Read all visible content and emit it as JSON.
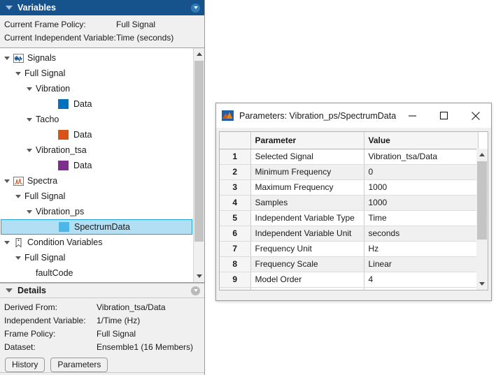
{
  "variables_panel": {
    "title": "Variables",
    "caret_icon": "caret-down-icon",
    "options_icon": "options-dropdown-icon",
    "properties": [
      {
        "label": "Current Frame Policy:",
        "value": "Full Signal"
      },
      {
        "label": "Current Independent Variable:",
        "value": "Time (seconds)"
      }
    ],
    "tree": [
      {
        "label": "Signals",
        "indent": 0,
        "twisty": true,
        "icon": "signals-waveform-icon",
        "selected": false
      },
      {
        "label": "Full Signal",
        "indent": 1,
        "twisty": true,
        "icon": null,
        "selected": false
      },
      {
        "label": "Vibration",
        "indent": 2,
        "twisty": true,
        "icon": null,
        "selected": false
      },
      {
        "label": "Data",
        "indent": 4,
        "twisty": false,
        "icon": null,
        "swatch": "#0072bd",
        "selected": false
      },
      {
        "label": "Tacho",
        "indent": 2,
        "twisty": true,
        "icon": null,
        "selected": false
      },
      {
        "label": "Data",
        "indent": 4,
        "twisty": false,
        "icon": null,
        "swatch": "#d95319",
        "selected": false
      },
      {
        "label": "Vibration_tsa",
        "indent": 2,
        "twisty": true,
        "icon": null,
        "selected": false
      },
      {
        "label": "Data",
        "indent": 4,
        "twisty": false,
        "icon": null,
        "swatch": "#7e2f8e",
        "selected": false
      },
      {
        "label": "Spectra",
        "indent": 0,
        "twisty": true,
        "icon": "spectra-peak-icon",
        "selected": false
      },
      {
        "label": "Full Signal",
        "indent": 1,
        "twisty": true,
        "icon": null,
        "selected": false
      },
      {
        "label": "Vibration_ps",
        "indent": 2,
        "twisty": true,
        "icon": null,
        "selected": false
      },
      {
        "label": "SpectrumData",
        "indent": 4,
        "twisty": false,
        "icon": null,
        "swatch": "#4db8e8",
        "selected": true
      },
      {
        "label": "Condition Variables",
        "indent": 0,
        "twisty": true,
        "icon": "condition-tag-icon",
        "selected": false
      },
      {
        "label": "Full Signal",
        "indent": 1,
        "twisty": true,
        "icon": null,
        "selected": false
      },
      {
        "label": "faultCode",
        "indent": 2,
        "twisty": false,
        "icon": null,
        "selected": false
      }
    ],
    "scrollbar": {
      "up_arrow_icon": "scroll-up-arrow-icon",
      "down_arrow_icon": "scroll-down-arrow-icon"
    }
  },
  "details_panel": {
    "title": "Details",
    "caret_icon": "caret-down-icon",
    "options_icon": "options-dropdown-icon",
    "properties": [
      {
        "label": "Derived From:",
        "value": "Vibration_tsa/Data"
      },
      {
        "label": "Independent Variable:",
        "value": "1/Time (Hz)"
      },
      {
        "label": "Frame Policy:",
        "value": "Full Signal"
      },
      {
        "label": "Dataset:",
        "value": "Ensemble1 (16 Members)"
      }
    ],
    "buttons": [
      {
        "label": "History"
      },
      {
        "label": "Parameters"
      }
    ]
  },
  "params_dialog": {
    "title": "Parameters: Vibration_ps/SpectrumData",
    "app_icon": "matlab-membrane-icon",
    "window_buttons": [
      {
        "name": "minimize-button",
        "glyph": "minimize-icon"
      },
      {
        "name": "maximize-button",
        "glyph": "maximize-icon"
      },
      {
        "name": "close-button",
        "glyph": "close-icon"
      }
    ],
    "table": {
      "columns": [
        "",
        "Parameter",
        "Value"
      ],
      "rows": [
        {
          "num": "1",
          "parameter": "Selected Signal",
          "value": "Vibration_tsa/Data"
        },
        {
          "num": "2",
          "parameter": "Minimum Frequency",
          "value": "0"
        },
        {
          "num": "3",
          "parameter": "Maximum Frequency",
          "value": "1000"
        },
        {
          "num": "4",
          "parameter": "Samples",
          "value": "1000"
        },
        {
          "num": "5",
          "parameter": "Independent Variable Type",
          "value": "Time"
        },
        {
          "num": "6",
          "parameter": "Independent Variable Unit",
          "value": "seconds"
        },
        {
          "num": "7",
          "parameter": "Frequency Unit",
          "value": "Hz"
        },
        {
          "num": "8",
          "parameter": "Frequency Scale",
          "value": "Linear"
        },
        {
          "num": "9",
          "parameter": "Model Order",
          "value": "4"
        }
      ]
    },
    "scrollbar": {
      "up_arrow_icon": "scroll-up-arrow-icon",
      "down_arrow_icon": "scroll-down-arrow-icon"
    }
  },
  "colors": {
    "header_blue": "#16538c",
    "selection_fill": "#b3dff5",
    "selection_border": "#1ba1e2",
    "series_blue": "#0072bd",
    "series_orange": "#d95319",
    "series_purple": "#7e2f8e"
  }
}
